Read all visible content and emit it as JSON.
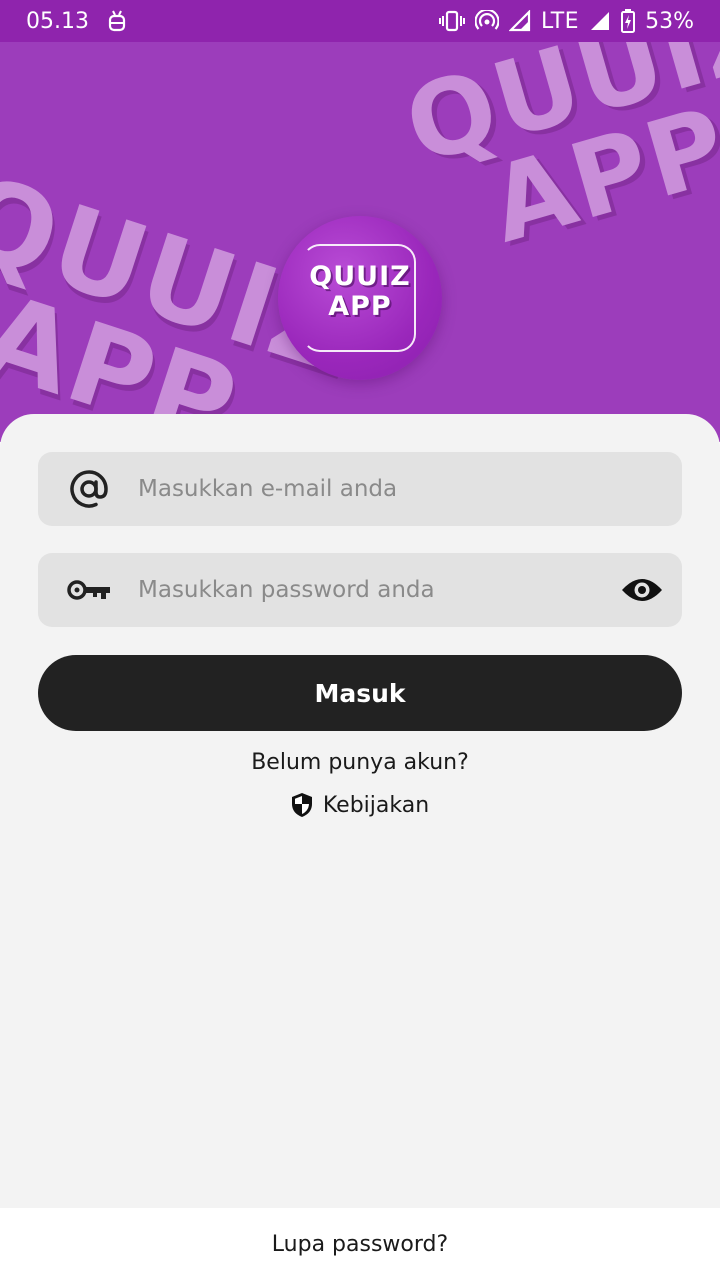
{
  "status_bar": {
    "time": "05.13",
    "network": "LTE",
    "battery": "53%"
  },
  "header": {
    "background_text_line1": "QUUIZ",
    "background_text_line2": "APP",
    "logo_line1": "QUUIZ",
    "logo_line2": "APP"
  },
  "login_form": {
    "email_placeholder": "Masukkan e-mail anda",
    "password_placeholder": "Masukkan password anda",
    "submit_label": "Masuk",
    "signup_label": "Belum punya akun?",
    "policy_label": "Kebijakan"
  },
  "footer": {
    "forgot_label": "Lupa password?"
  },
  "colors": {
    "status_bar": "#8f24ad",
    "header": "#9c3dbb",
    "card": "#f3f3f3",
    "input": "#e2e2e2",
    "button": "#222222"
  },
  "icons": {
    "status_left": [
      "android-debug-icon"
    ],
    "status_right": [
      "vibrate-icon",
      "hotspot-icon",
      "signal-icon",
      "signal-icon",
      "battery-charging-icon"
    ],
    "email_field": "at-sign-icon",
    "password_field": "key-icon",
    "password_toggle": "eye-icon",
    "policy": "shield-icon"
  }
}
